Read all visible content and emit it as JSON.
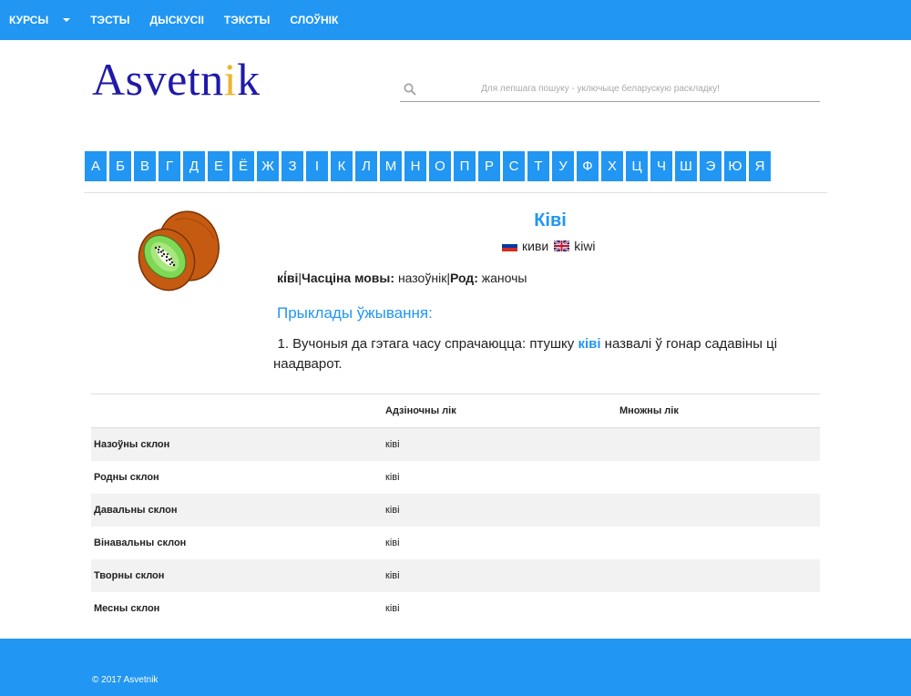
{
  "nav": {
    "items": [
      "КУРСЫ",
      "ТЭСТЫ",
      "ДЫСКУСІІ",
      "ТЭКСТЫ",
      "СЛОЎНІК"
    ]
  },
  "logo": {
    "part1": "Asvetn",
    "accent": "i",
    "part2": "k"
  },
  "search": {
    "placeholder": "Для лепшага пошуку - уключыце беларускую раскладку!",
    "value": ""
  },
  "alphabet": [
    "А",
    "Б",
    "В",
    "Г",
    "Д",
    "Е",
    "Ё",
    "Ж",
    "З",
    "І",
    "К",
    "Л",
    "М",
    "Н",
    "О",
    "П",
    "Р",
    "С",
    "Т",
    "У",
    "Ф",
    "Х",
    "Ц",
    "Ч",
    "Ш",
    "Э",
    "Ю",
    "Я"
  ],
  "word": {
    "title": "Ківі",
    "translation_ru": "киви",
    "translation_en": "kiwi",
    "stressed": "кі́ві",
    "pos_label": "Часціна мовы:",
    "pos_value": "назоўнік",
    "gender_label": "Род:",
    "gender_value": "жаночы"
  },
  "examples": {
    "title": "Прыклады ўжывання:",
    "items": [
      {
        "num": "1.",
        "before": "Вучоныя да гэтага часу спрачаюцца: птушку ",
        "highlight": "ківі",
        "after": " назвалі ў гонар садавіны ці наадварот."
      }
    ]
  },
  "declension": {
    "headers": [
      "",
      "Адзіночны лік",
      "Множны лік"
    ],
    "rows": [
      {
        "case": "Назоўны склон",
        "singular": "ківі",
        "plural": ""
      },
      {
        "case": "Родны склон",
        "singular": "ківі",
        "plural": ""
      },
      {
        "case": "Давальны склон",
        "singular": "ківі",
        "plural": ""
      },
      {
        "case": "Вінавальны склон",
        "singular": "ківі",
        "plural": ""
      },
      {
        "case": "Творны склон",
        "singular": "ківі",
        "plural": ""
      },
      {
        "case": "Месны склон",
        "singular": "ківі",
        "plural": ""
      }
    ]
  },
  "footer": {
    "copyright": "© 2017 Asvetnik"
  },
  "colors": {
    "primary": "#2196f3",
    "logo": "#1f1aa8",
    "logo_accent": "#f0b429"
  }
}
